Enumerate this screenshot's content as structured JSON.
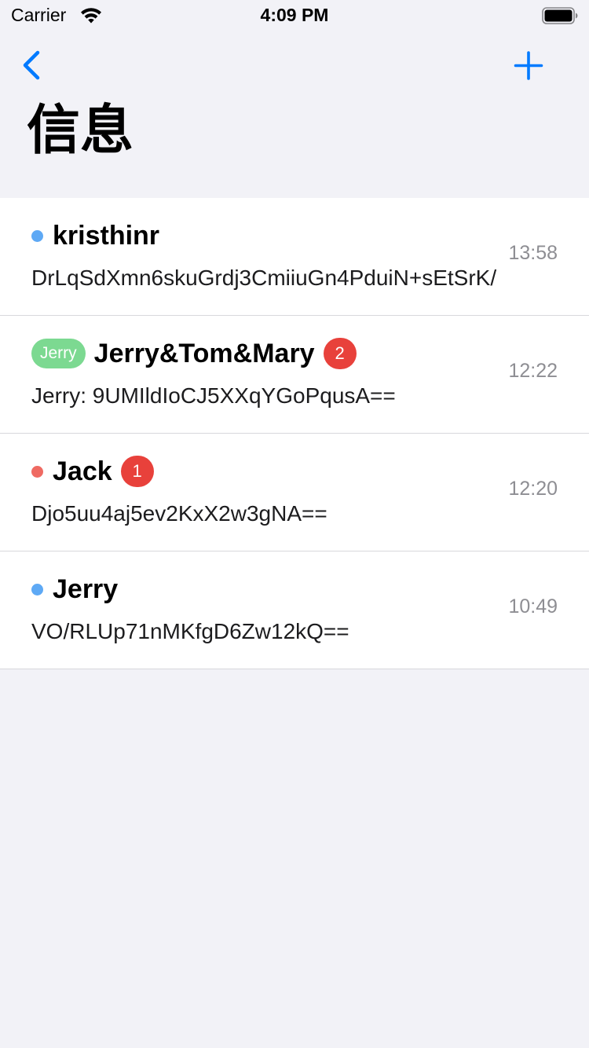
{
  "status_bar": {
    "carrier": "Carrier",
    "time": "4:09 PM"
  },
  "nav": {
    "back_icon": "chevron-left-icon",
    "add_icon": "plus-icon",
    "title": "信息"
  },
  "colors": {
    "accent": "#007aff",
    "badge": "#e8413b",
    "dot_blue": "#5ea9f5",
    "dot_red": "#ef6a62",
    "tag_green": "#7cd991"
  },
  "conversations": [
    {
      "dot_color": "#5ea9f5",
      "sender_tag": "",
      "name": "kristhinr",
      "unread": "",
      "preview": "DrLqSdXmn6skuGrdj3CmiiuGn4PduiN+sEtSrK/",
      "time": "13:58"
    },
    {
      "dot_color": "",
      "sender_tag": "Jerry",
      "name": "Jerry&Tom&Mary",
      "unread": "2",
      "preview": "Jerry: 9UMIldIoCJ5XXqYGoPqusA==",
      "time": "12:22"
    },
    {
      "dot_color": "#ef6a62",
      "sender_tag": "",
      "name": "Jack",
      "unread": "1",
      "preview": "Djo5uu4aj5ev2KxX2w3gNA==",
      "time": "12:20"
    },
    {
      "dot_color": "#5ea9f5",
      "sender_tag": "",
      "name": "Jerry",
      "unread": "",
      "preview": "VO/RLUp71nMKfgD6Zw12kQ==",
      "time": "10:49"
    }
  ]
}
